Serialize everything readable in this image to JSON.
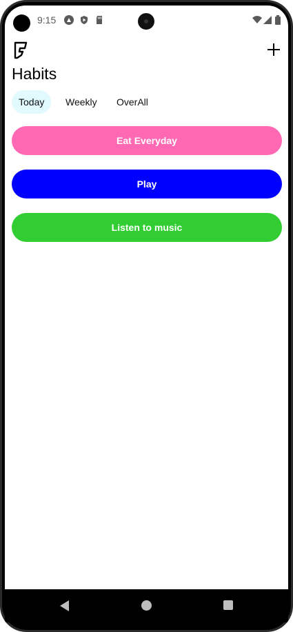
{
  "status_bar": {
    "time": "9:15",
    "notification_icons": [
      "assistant-icon",
      "play-shield-icon",
      "sd-card-icon"
    ],
    "system_icons": [
      "wifi-icon",
      "signal-icon",
      "battery-icon"
    ]
  },
  "app_bar": {
    "logo_icon": "foursquare-flag-icon",
    "add_icon": "plus-icon"
  },
  "page_title": "Habits",
  "tabs": [
    {
      "label": "Today",
      "active": true
    },
    {
      "label": "Weekly",
      "active": false
    },
    {
      "label": "OverAll",
      "active": false
    }
  ],
  "habits": [
    {
      "label": "Eat Everyday",
      "color": "#ff69b4"
    },
    {
      "label": "Play",
      "color": "#0000ff"
    },
    {
      "label": "Listen to music",
      "color": "#32cd32"
    }
  ],
  "nav_bar": {
    "icons": [
      "back-icon",
      "home-icon",
      "recents-icon"
    ]
  },
  "colors": {
    "active_tab_bg": "#e0fafd",
    "background": "#ffffff"
  }
}
